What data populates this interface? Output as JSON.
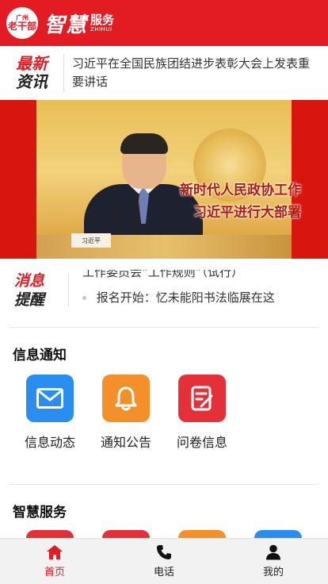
{
  "header": {
    "badge_line1": "广州",
    "badge_line2": "老干部",
    "brand_zh": "智慧",
    "brand_service": "服务",
    "brand_en": "ZHIHUI"
  },
  "news": {
    "logo_top": "最新",
    "logo_bottom": "资讯",
    "headline": "习近平在全国民族团结进步表彰大会上发表重要讲话"
  },
  "banner": {
    "caption_line1": "新时代人民政协工作",
    "caption_line2": "习近平进行大部署",
    "nameplate": "习近平"
  },
  "notice": {
    "logo_top": "消息",
    "logo_bottom": "提醒",
    "items": [
      "工作委员会“工作规则”（试行）",
      "报名开始：忆未能阳书法临展在这"
    ]
  },
  "info_section": {
    "title": "信息通知",
    "items": [
      {
        "label": "信息动态",
        "icon": "mail-icon",
        "color": "#2a8ef0"
      },
      {
        "label": "通知公告",
        "icon": "bell-icon",
        "color": "#f4902a"
      },
      {
        "label": "问卷信息",
        "icon": "survey-icon",
        "color": "#e5303a"
      }
    ]
  },
  "smart_section": {
    "title": "智慧服务",
    "tile_colors": [
      "#e5303a",
      "#e5303a",
      "#f4902a",
      "#2a8ef0"
    ]
  },
  "tabbar": {
    "tabs": [
      {
        "label": "首页",
        "icon": "home-icon",
        "active": true
      },
      {
        "label": "电话",
        "icon": "phone-icon",
        "active": false
      },
      {
        "label": "我的",
        "icon": "user-icon",
        "active": false
      }
    ]
  },
  "colors": {
    "primary": "#e31b23",
    "text": "#333333"
  }
}
